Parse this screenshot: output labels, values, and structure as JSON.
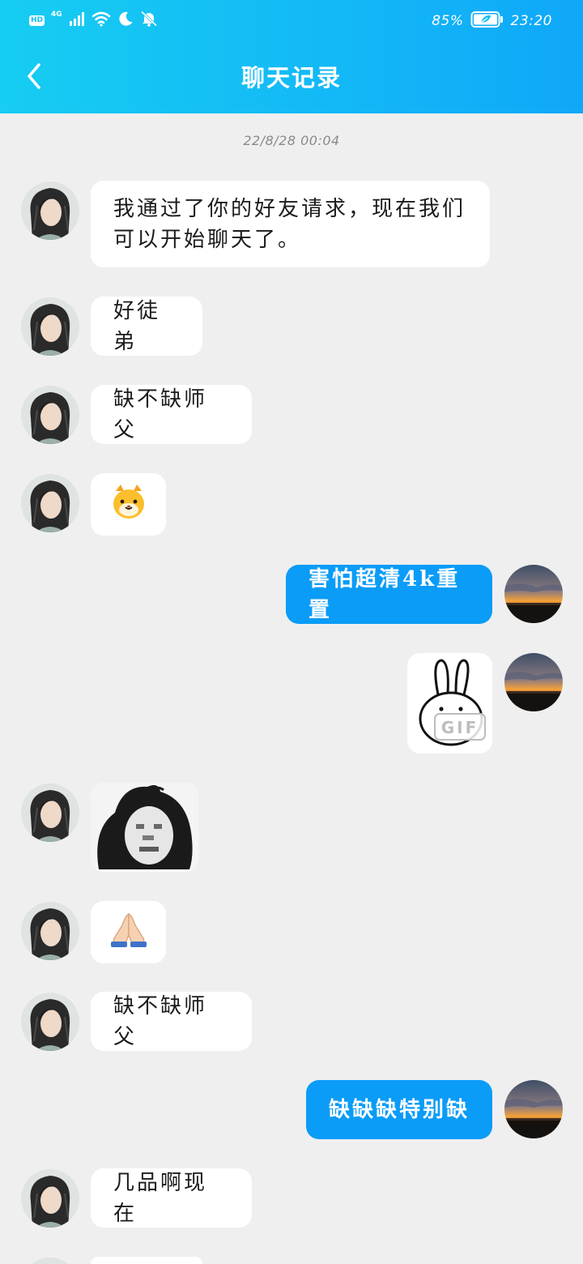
{
  "status_bar": {
    "hd": "HD",
    "network": "4G",
    "battery": "85%",
    "time": "23:20",
    "icons": [
      "signal-icon",
      "wifi-icon",
      "moon-icon",
      "mute-bell-icon",
      "battery-icon"
    ]
  },
  "nav": {
    "title": "聊天记录",
    "back_icon": "chevron-left-icon"
  },
  "timestamp": "22/8/28  00:04",
  "colors": {
    "header_gradient_start": "#16cdf2",
    "header_gradient_end": "#0fa8f8",
    "outgoing_bubble": "#0a9cf7",
    "incoming_bubble": "#ffffff",
    "background": "#efefef"
  },
  "messages": [
    {
      "side": "in",
      "type": "text",
      "text": "我通过了你的好友请求，现在我们可以开始聊天了。"
    },
    {
      "side": "in",
      "type": "text",
      "text": "好徒弟"
    },
    {
      "side": "in",
      "type": "text",
      "text": "缺不缺师父"
    },
    {
      "side": "in",
      "type": "sticker",
      "sticker": "hamster-emoji-sticker"
    },
    {
      "side": "out",
      "type": "text",
      "text": "害怕超清4k重置"
    },
    {
      "side": "out",
      "type": "sticker",
      "sticker": "bunny-gif-sticker",
      "badge": "GIF"
    },
    {
      "side": "in",
      "type": "sticker",
      "sticker": "blurry-meme-face-sticker"
    },
    {
      "side": "in",
      "type": "sticker",
      "sticker": "praying-hands-emoji"
    },
    {
      "side": "in",
      "type": "text",
      "text": "缺不缺师父"
    },
    {
      "side": "out",
      "type": "text",
      "text": "缺缺缺特别缺"
    },
    {
      "side": "in",
      "type": "text",
      "text": "几品啊现在"
    }
  ]
}
